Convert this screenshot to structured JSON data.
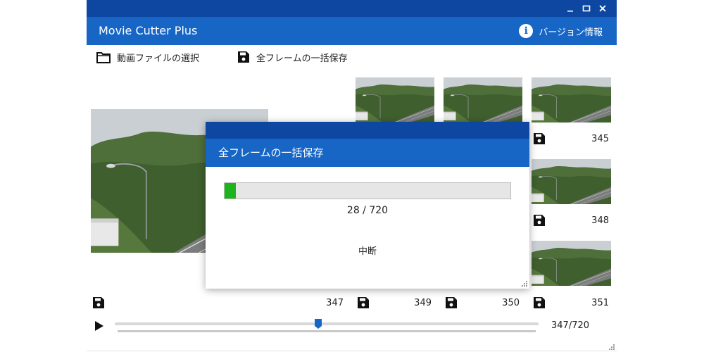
{
  "window": {
    "minimize_icon": "minimize-icon",
    "maximize_icon": "maximize-icon",
    "close_icon": "close-icon"
  },
  "app": {
    "title": "Movie Cutter Plus",
    "version_label": "バージョン情報"
  },
  "toolbar": {
    "open_label": "動画ファイルの選択",
    "save_all_label": "全フレームの一括保存"
  },
  "frames": {
    "main": "347",
    "grid": [
      "349",
      "350",
      "351",
      "348",
      "345"
    ]
  },
  "playback": {
    "position_text": "347/720",
    "progress": 0.48
  },
  "dialog": {
    "title": "全フレームの一括保存",
    "progress_text": "28 / 720",
    "progress": 0.039,
    "abort_label": "中断"
  },
  "colors": {
    "titlebar": "#0e47a1",
    "appbar": "#1766c5",
    "progress": "#1db31d",
    "slider_handle": "#1766c5"
  }
}
